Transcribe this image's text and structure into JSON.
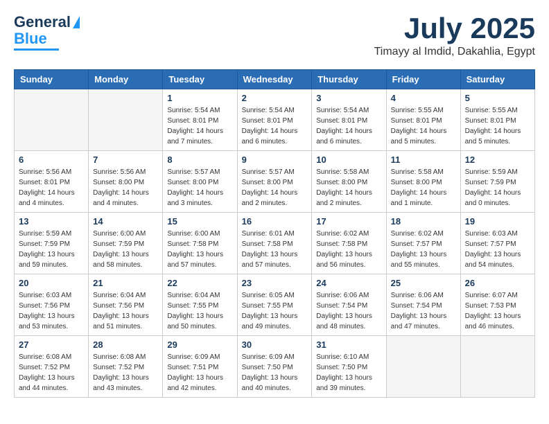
{
  "header": {
    "logo_general": "General",
    "logo_blue": "Blue",
    "month": "July 2025",
    "location": "Timayy al Imdid, Dakahlia, Egypt"
  },
  "days_of_week": [
    "Sunday",
    "Monday",
    "Tuesday",
    "Wednesday",
    "Thursday",
    "Friday",
    "Saturday"
  ],
  "weeks": [
    [
      {
        "day": "",
        "info": ""
      },
      {
        "day": "",
        "info": ""
      },
      {
        "day": "1",
        "info": "Sunrise: 5:54 AM\nSunset: 8:01 PM\nDaylight: 14 hours and 7 minutes."
      },
      {
        "day": "2",
        "info": "Sunrise: 5:54 AM\nSunset: 8:01 PM\nDaylight: 14 hours and 6 minutes."
      },
      {
        "day": "3",
        "info": "Sunrise: 5:54 AM\nSunset: 8:01 PM\nDaylight: 14 hours and 6 minutes."
      },
      {
        "day": "4",
        "info": "Sunrise: 5:55 AM\nSunset: 8:01 PM\nDaylight: 14 hours and 5 minutes."
      },
      {
        "day": "5",
        "info": "Sunrise: 5:55 AM\nSunset: 8:01 PM\nDaylight: 14 hours and 5 minutes."
      }
    ],
    [
      {
        "day": "6",
        "info": "Sunrise: 5:56 AM\nSunset: 8:01 PM\nDaylight: 14 hours and 4 minutes."
      },
      {
        "day": "7",
        "info": "Sunrise: 5:56 AM\nSunset: 8:00 PM\nDaylight: 14 hours and 4 minutes."
      },
      {
        "day": "8",
        "info": "Sunrise: 5:57 AM\nSunset: 8:00 PM\nDaylight: 14 hours and 3 minutes."
      },
      {
        "day": "9",
        "info": "Sunrise: 5:57 AM\nSunset: 8:00 PM\nDaylight: 14 hours and 2 minutes."
      },
      {
        "day": "10",
        "info": "Sunrise: 5:58 AM\nSunset: 8:00 PM\nDaylight: 14 hours and 2 minutes."
      },
      {
        "day": "11",
        "info": "Sunrise: 5:58 AM\nSunset: 8:00 PM\nDaylight: 14 hours and 1 minute."
      },
      {
        "day": "12",
        "info": "Sunrise: 5:59 AM\nSunset: 7:59 PM\nDaylight: 14 hours and 0 minutes."
      }
    ],
    [
      {
        "day": "13",
        "info": "Sunrise: 5:59 AM\nSunset: 7:59 PM\nDaylight: 13 hours and 59 minutes."
      },
      {
        "day": "14",
        "info": "Sunrise: 6:00 AM\nSunset: 7:59 PM\nDaylight: 13 hours and 58 minutes."
      },
      {
        "day": "15",
        "info": "Sunrise: 6:00 AM\nSunset: 7:58 PM\nDaylight: 13 hours and 57 minutes."
      },
      {
        "day": "16",
        "info": "Sunrise: 6:01 AM\nSunset: 7:58 PM\nDaylight: 13 hours and 57 minutes."
      },
      {
        "day": "17",
        "info": "Sunrise: 6:02 AM\nSunset: 7:58 PM\nDaylight: 13 hours and 56 minutes."
      },
      {
        "day": "18",
        "info": "Sunrise: 6:02 AM\nSunset: 7:57 PM\nDaylight: 13 hours and 55 minutes."
      },
      {
        "day": "19",
        "info": "Sunrise: 6:03 AM\nSunset: 7:57 PM\nDaylight: 13 hours and 54 minutes."
      }
    ],
    [
      {
        "day": "20",
        "info": "Sunrise: 6:03 AM\nSunset: 7:56 PM\nDaylight: 13 hours and 53 minutes."
      },
      {
        "day": "21",
        "info": "Sunrise: 6:04 AM\nSunset: 7:56 PM\nDaylight: 13 hours and 51 minutes."
      },
      {
        "day": "22",
        "info": "Sunrise: 6:04 AM\nSunset: 7:55 PM\nDaylight: 13 hours and 50 minutes."
      },
      {
        "day": "23",
        "info": "Sunrise: 6:05 AM\nSunset: 7:55 PM\nDaylight: 13 hours and 49 minutes."
      },
      {
        "day": "24",
        "info": "Sunrise: 6:06 AM\nSunset: 7:54 PM\nDaylight: 13 hours and 48 minutes."
      },
      {
        "day": "25",
        "info": "Sunrise: 6:06 AM\nSunset: 7:54 PM\nDaylight: 13 hours and 47 minutes."
      },
      {
        "day": "26",
        "info": "Sunrise: 6:07 AM\nSunset: 7:53 PM\nDaylight: 13 hours and 46 minutes."
      }
    ],
    [
      {
        "day": "27",
        "info": "Sunrise: 6:08 AM\nSunset: 7:52 PM\nDaylight: 13 hours and 44 minutes."
      },
      {
        "day": "28",
        "info": "Sunrise: 6:08 AM\nSunset: 7:52 PM\nDaylight: 13 hours and 43 minutes."
      },
      {
        "day": "29",
        "info": "Sunrise: 6:09 AM\nSunset: 7:51 PM\nDaylight: 13 hours and 42 minutes."
      },
      {
        "day": "30",
        "info": "Sunrise: 6:09 AM\nSunset: 7:50 PM\nDaylight: 13 hours and 40 minutes."
      },
      {
        "day": "31",
        "info": "Sunrise: 6:10 AM\nSunset: 7:50 PM\nDaylight: 13 hours and 39 minutes."
      },
      {
        "day": "",
        "info": ""
      },
      {
        "day": "",
        "info": ""
      }
    ]
  ]
}
